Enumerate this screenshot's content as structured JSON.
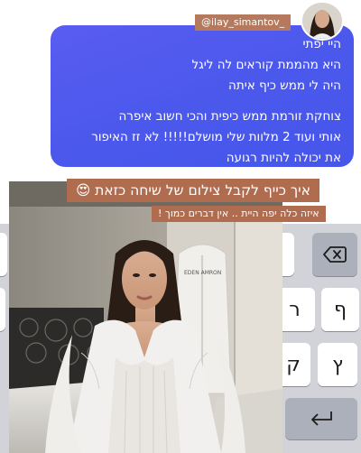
{
  "story": {
    "mention_tag": "@ilay_simantov_",
    "caption_main": "איך כייף לקבל צילום של שיחה כזאת 😍",
    "caption_sub": "איזה כלה יפה היית .. אין דברים כמוך !"
  },
  "message": {
    "lines": [
      "היי יפתי",
      "היא מהממת קוראים לה ליגל",
      "היה לי ממש כיף איתה",
      "צוחקת זורמת ממש כיפית והכי חשוב איפרה",
      "אותי ועוד 2 מלוות שלי מושלם!!!!! לא זז האיפור",
      "את יכולה להיות רגועה"
    ],
    "bubble_color": "#4f57ee"
  },
  "keyboard": {
    "keys": [
      "ף",
      "ר",
      "ק",
      "ץ"
    ],
    "delete_icon": "backspace-icon",
    "return_icon": "return-icon"
  },
  "photo": {
    "banner_text": "EDEN AMRON"
  },
  "colors": {
    "sticker": "#b06c4f",
    "keyboard_bg": "#d2d3d8"
  }
}
